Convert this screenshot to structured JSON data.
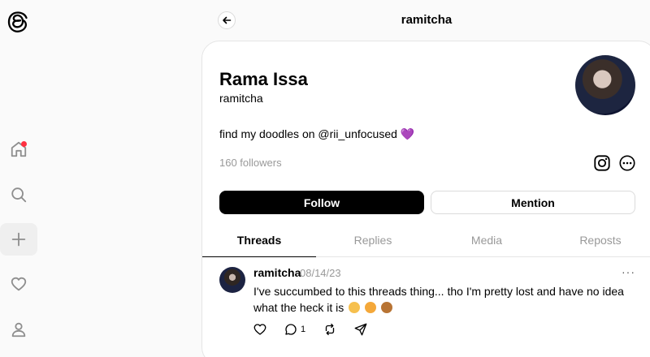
{
  "header": {
    "title": "ramitcha"
  },
  "profile": {
    "name": "Rama Issa",
    "handle": "ramitcha",
    "bio": "find my doodles on @rii_unfocused",
    "bio_emoji": "💜",
    "followers": "160 followers"
  },
  "buttons": {
    "follow": "Follow",
    "mention": "Mention"
  },
  "tabs": [
    {
      "label": "Threads",
      "active": true
    },
    {
      "label": "Replies",
      "active": false
    },
    {
      "label": "Media",
      "active": false
    },
    {
      "label": "Reposts",
      "active": false
    }
  ],
  "post": {
    "user": "ramitcha",
    "date": "08/14/23",
    "more": "···",
    "text": "I've succumbed to this threads thing... tho I'm pretty lost and have no idea what the heck it is",
    "reply_count": "1"
  },
  "icons": {
    "logo": "threads-logo-icon",
    "nav": [
      "home-icon",
      "search-icon",
      "plus-icon",
      "heart-icon",
      "profile-icon"
    ],
    "profile_actions": [
      "instagram-icon",
      "more-circle-icon"
    ],
    "post_actions": [
      "like-icon",
      "comment-icon",
      "repost-icon",
      "share-icon"
    ]
  },
  "colors": {
    "accent": "#000000",
    "notification": "#ff3040",
    "heart": "#8e44ec"
  }
}
